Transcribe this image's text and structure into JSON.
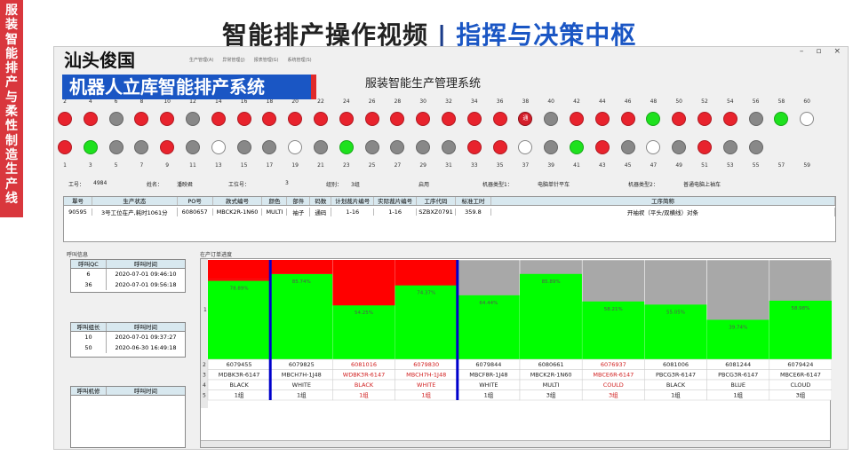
{
  "banner": {
    "text": "服装智能排产与柔性制造生产线"
  },
  "headline": {
    "left": "智能排产操作视频",
    "sep": "|",
    "right": "指挥与决策中枢"
  },
  "company": "汕头俊国",
  "system_badge": "机器人立库智能排产系统",
  "app": {
    "title": "服装智能生产管理系统",
    "menu": [
      "生产管理(A)",
      "异常管理(J)",
      "报表管理(G)",
      "系统管理(S)"
    ],
    "controls": [
      "–",
      "▫",
      "×"
    ]
  },
  "top_numbers": [
    "2",
    "4",
    "6",
    "8",
    "10",
    "12",
    "14",
    "16",
    "18",
    "20",
    "22",
    "24",
    "26",
    "28",
    "30",
    "32",
    "34",
    "36",
    "38",
    "40",
    "42",
    "44",
    "46",
    "48",
    "50",
    "52",
    "54",
    "56",
    "58",
    "60"
  ],
  "top_lamps": [
    "r",
    "r",
    "y",
    "r",
    "r",
    "y",
    "r",
    "r",
    "r",
    "r",
    "r",
    "r",
    "r",
    "r",
    "r",
    "r",
    "r",
    "r",
    "d",
    "y",
    "r",
    "r",
    "r",
    "g",
    "r",
    "r",
    "r",
    "y",
    "g",
    "w"
  ],
  "bottom_lamps": [
    "r",
    "g",
    "y",
    "y",
    "r",
    "y",
    "w",
    "y",
    "y",
    "w",
    "y",
    "g",
    "y",
    "y",
    "y",
    "y",
    "r",
    "r",
    "w",
    "y",
    "g",
    "r",
    "y",
    "w",
    "y",
    "r",
    "y",
    "y"
  ],
  "bottom_numbers": [
    "1",
    "3",
    "5",
    "7",
    "9",
    "11",
    "13",
    "15",
    "17",
    "19",
    "21",
    "23",
    "25",
    "27",
    "29",
    "31",
    "33",
    "35",
    "37",
    "39",
    "41",
    "43",
    "45",
    "47",
    "49",
    "51",
    "53",
    "55",
    "57",
    "59"
  ],
  "lamp_label": "通",
  "info": {
    "worker_label": "工号：",
    "worker": "4984",
    "name_label": "姓名：",
    "name": "潘映君",
    "station_label": "工位号：",
    "station": "3",
    "group_label": "组别：",
    "group": "3组",
    "status": "启用",
    "m1_label": "机器类型1：",
    "m1": "电脑单针平车",
    "m2_label": "机器类型2：",
    "m2": "普通电脑上袖车"
  },
  "status_table": {
    "headers": [
      "單号",
      "生产状态",
      "PO号",
      "款式编号",
      "颜色",
      "部件",
      "码数",
      "计划裁片编号",
      "实际裁片编号",
      "工序代码",
      "标准工时",
      "工序简称"
    ],
    "row": [
      "90595",
      "3号工位在产,耗时1061分",
      "6080657",
      "MBCK2R-1N60",
      "MULTI",
      "袖子",
      "通码",
      "1-16",
      "1-16",
      "SZBXZ0791",
      "359.8",
      "开袖衩（平头/双横线）对条"
    ]
  },
  "call_info": {
    "label": "呼叫信息",
    "qc": {
      "headers": [
        "呼叫QC",
        "呼叫时间"
      ],
      "rows": [
        [
          "6",
          "2020-07-01 09:46:10"
        ],
        [
          "36",
          "2020-07-01 09:56:18"
        ]
      ]
    },
    "leader": {
      "headers": [
        "呼叫组长",
        "呼叫时间"
      ],
      "rows": [
        [
          "10",
          "2020-07-01 09:37:27"
        ],
        [
          "50",
          "2020-06-30 16:49:18"
        ]
      ]
    },
    "mechanic": {
      "headers": [
        "呼叫机修",
        "呼叫时间"
      ],
      "rows": []
    }
  },
  "progress_label": "在产订单进度",
  "chart_data": {
    "type": "bar",
    "row_labels": [
      "1",
      "2",
      "3",
      "4",
      "5"
    ],
    "orders": [
      {
        "po": "6079455",
        "style": "MDBK3R-6147",
        "color": "BLACK",
        "group": "1组",
        "pct": 78.89,
        "pct_label": "78.89%",
        "red_frac": 0.19,
        "alert": false
      },
      {
        "po": "6079825",
        "style": "MBCH7H-1J48",
        "color": "WHITE",
        "group": "1组",
        "pct": 85.74,
        "pct_label": "85.74%",
        "red_frac": 0.14,
        "alert": false
      },
      {
        "po": "6081016",
        "style": "WDBK3R-6147",
        "color": "BLACK",
        "group": "1组",
        "pct": 54.25,
        "pct_label": "54.25%",
        "red_frac": 0.46,
        "alert": true
      },
      {
        "po": "6079830",
        "style": "MBCH7H-1J48",
        "color": "WHITE",
        "group": "1组",
        "pct": 74.37,
        "pct_label": "74.37%",
        "red_frac": 0.26,
        "alert": true
      },
      {
        "po": "6079844",
        "style": "MBCF8R-1J48",
        "color": "WHITE",
        "group": "1组",
        "pct": 64.44,
        "pct_label": "64.44%",
        "red_frac": 0,
        "alert": false
      },
      {
        "po": "6080661",
        "style": "MBCK2R-1N60",
        "color": "MULTI",
        "group": "3组",
        "pct": 85.89,
        "pct_label": "85.89%",
        "red_frac": 0,
        "alert": false
      },
      {
        "po": "6076937",
        "style": "MBCE6R-6147",
        "color": "COULD",
        "group": "3组",
        "pct": 58.21,
        "pct_label": "58.21%",
        "red_frac": 0,
        "alert": true
      },
      {
        "po": "6081006",
        "style": "PBCG3R-6147",
        "color": "BLACK",
        "group": "1组",
        "pct": 55.05,
        "pct_label": "55.05%",
        "red_frac": 0,
        "alert": false
      },
      {
        "po": "6081244",
        "style": "PBCG3R-6147",
        "color": "BLUE",
        "group": "1组",
        "pct": 39.74,
        "pct_label": "39.74%",
        "red_frac": 0,
        "alert": false
      },
      {
        "po": "6079424",
        "style": "MBCE6R-6147",
        "color": "CLOUD",
        "group": "3组",
        "pct": 58.98,
        "pct_label": "58.98%",
        "red_frac": 0,
        "alert": false
      }
    ],
    "dividers_after": [
      0,
      3
    ],
    "colors": {
      "done": "#00ff00",
      "remaining": "#a8a8a8",
      "urgent": "#ff0000",
      "divider": "#0000cc",
      "alert_text": "#d01c1c"
    }
  }
}
